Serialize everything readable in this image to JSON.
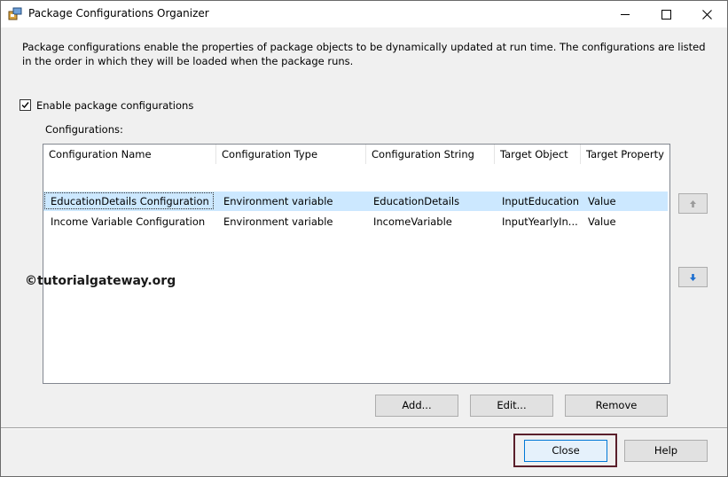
{
  "window": {
    "title": "Package Configurations Organizer"
  },
  "description": "Package configurations enable the properties of package objects to be dynamically updated at run time. The configurations are listed in the order in which they will be loaded when the package runs.",
  "enable_checkbox": {
    "label": "Enable package configurations",
    "checked": true
  },
  "configurations_label": "Configurations:",
  "table": {
    "columns": [
      "Configuration Name",
      "Configuration Type",
      "Configuration String",
      "Target Object",
      "Target Property"
    ],
    "rows": [
      [
        "EducationDetails Configuration",
        "Environment variable",
        "EducationDetails",
        "InputEducation",
        "Value"
      ],
      [
        "Income Variable Configuration",
        "Environment variable",
        "IncomeVariable",
        "InputYearlyIn...",
        "Value"
      ]
    ],
    "selected_row": 0
  },
  "buttons": {
    "add": "Add...",
    "edit": "Edit...",
    "remove": "Remove",
    "close": "Close",
    "help": "Help"
  },
  "watermark": "©tutorialgateway.org",
  "colors": {
    "selection": "#cce8ff",
    "dialog_bg": "#f0f0f0",
    "highlight_outline": "#5a1f2b",
    "arrow_icon": "#1e6fd0"
  }
}
